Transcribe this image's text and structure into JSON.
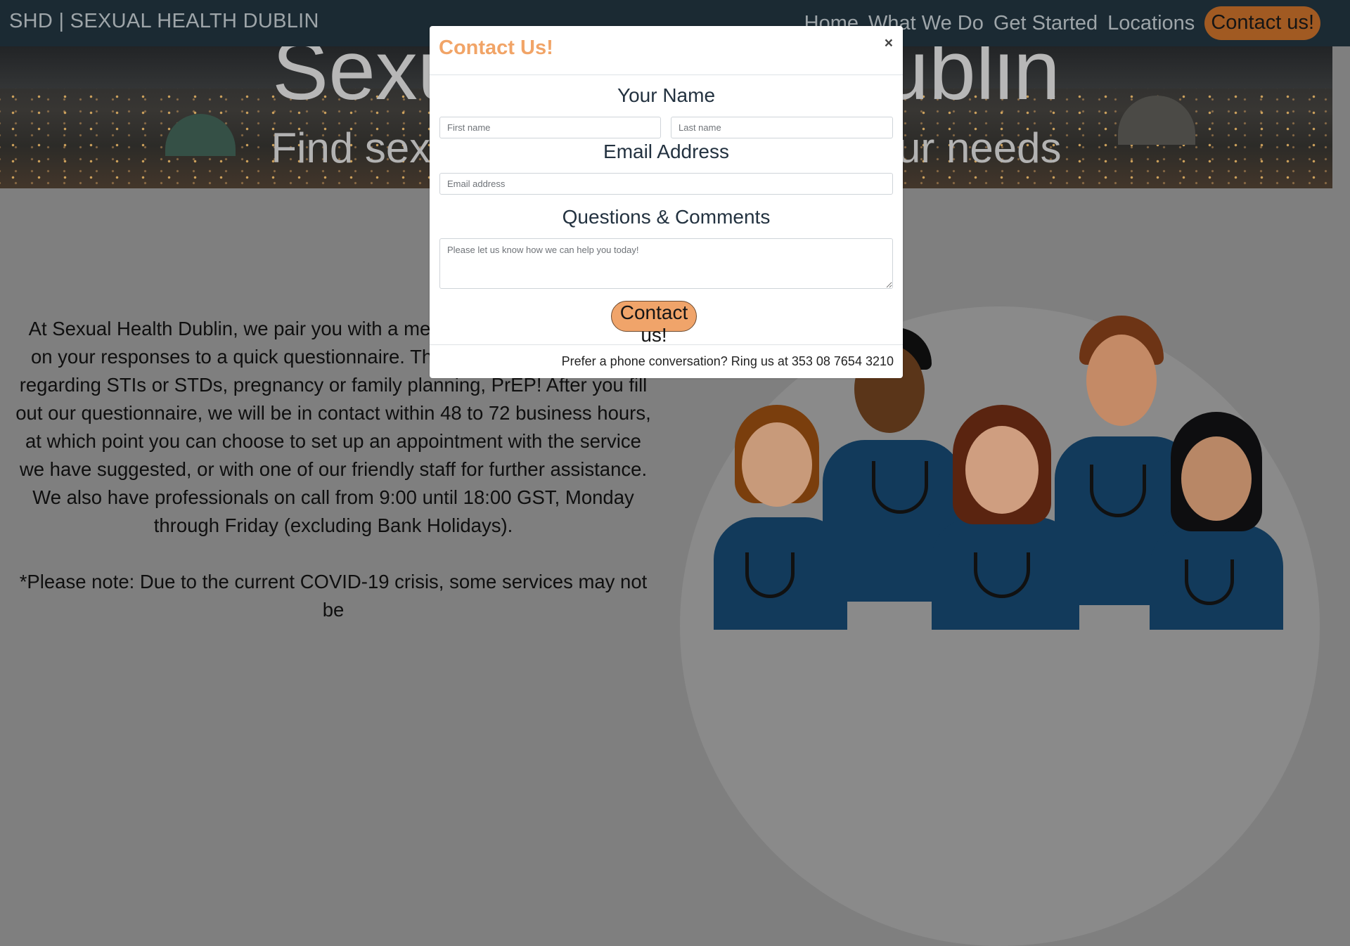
{
  "navbar": {
    "brand": "SHD | SEXUAL HEALTH DUBLIN",
    "links": [
      "Home",
      "What We Do",
      "Get Started",
      "Locations"
    ],
    "contact_button": "Contact us!"
  },
  "hero": {
    "title": "Sexual Health Dublin",
    "subtitle": "Find sexual health services for your needs"
  },
  "about": {
    "paragraph1": "At Sexual Health Dublin, we pair you with a medical professional based on your responses to a quick questionnaire. This can range to services regarding STIs or STDs, pregnancy or family planning, PrEP! After you fill out our questionnaire, we will be in contact within 48 to 72 business hours, at which point you can choose to set up an appointment with the service we have suggested, or with one of our friendly staff for further assistance. We also have professionals on call from 9:00 until 18:00 GST, Monday through Friday (excluding Bank Holidays).",
    "paragraph2": "*Please note: Due to the current COVID-19 crisis, some services may not be"
  },
  "modal": {
    "title": "Contact Us!",
    "close_glyph": "×",
    "name_label": "Your Name",
    "first_name_placeholder": "First name",
    "last_name_placeholder": "Last name",
    "email_label": "Email Address",
    "email_placeholder": "Email address",
    "comments_label": "Questions & Comments",
    "comments_placeholder": "Please let us know how we can help you today!",
    "submit_label": "Contact us!",
    "footer_text": "Prefer a phone conversation?  Ring us at 353 08 7654 3210"
  },
  "colors": {
    "accent": "#f0a46a",
    "navbar": "#1b2a33",
    "overlay": "#7f7f7f"
  }
}
